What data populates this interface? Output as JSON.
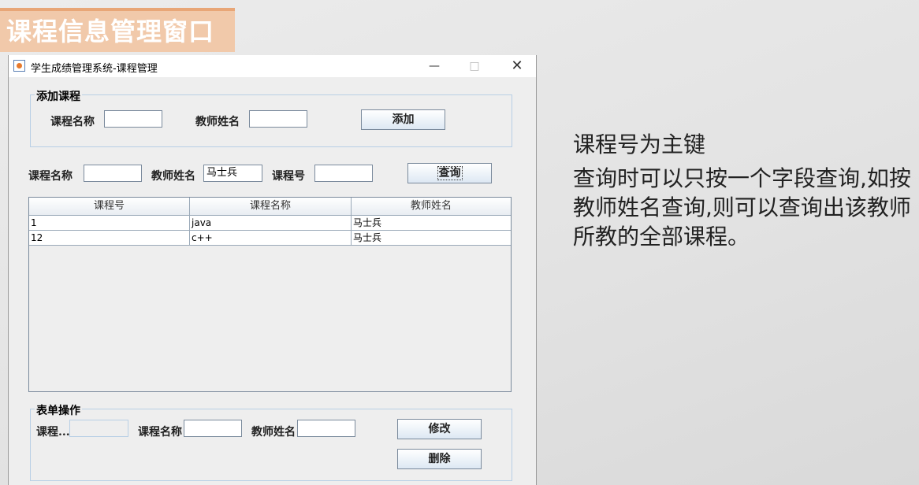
{
  "slide": {
    "title": "课程信息管理窗口",
    "notes": [
      "课程号为主键",
      "查询时可以只按一个字段查询,如按教师姓名查询,则可以查询出该教师所教的全部课程。"
    ]
  },
  "window": {
    "title": "学生成绩管理系统-课程管理",
    "controls": {
      "minimize": "—",
      "maximize": "□",
      "close": "✕"
    }
  },
  "add_group": {
    "title": "添加课程",
    "course_name_label": "课程名称",
    "course_name_value": "",
    "teacher_label": "教师姓名",
    "teacher_value": "",
    "add_button": "添加"
  },
  "query": {
    "course_name_label": "课程名称",
    "course_name_value": "",
    "teacher_label": "教师姓名",
    "teacher_value": "马士兵",
    "course_no_label": "课程号",
    "course_no_value": "",
    "query_button": "查询"
  },
  "table": {
    "columns": [
      "课程号",
      "课程名称",
      "教师姓名"
    ],
    "rows": [
      [
        "1",
        "java",
        "马士兵"
      ],
      [
        "12",
        "c++",
        "马士兵"
      ]
    ]
  },
  "form_group": {
    "title": "表单操作",
    "course_no_label": "课程...",
    "course_no_value": "",
    "course_name_label": "课程名称",
    "course_name_value": "",
    "teacher_label": "教师姓名",
    "teacher_value": "",
    "modify_button": "修改",
    "delete_button": "删除"
  },
  "colors": {
    "title_bg": "#f1c9aa",
    "title_text": "#ffffff",
    "group_border": "#b8cfe5",
    "window_bg": "#eeeeee"
  }
}
